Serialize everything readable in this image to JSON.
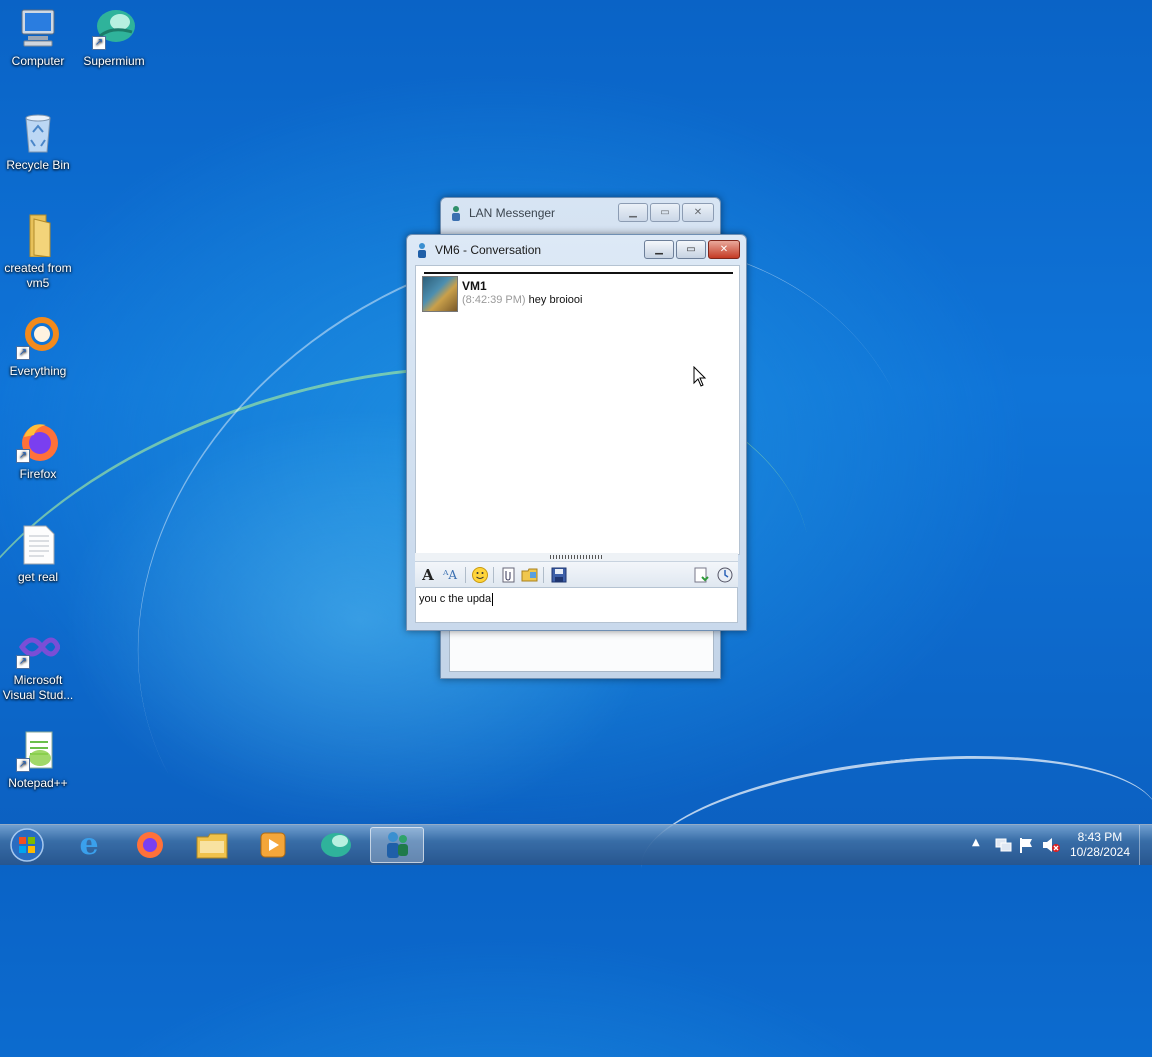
{
  "desktop": {
    "icons": [
      {
        "label": "Computer"
      },
      {
        "label": "Supermium"
      },
      {
        "label": "Recycle Bin"
      },
      {
        "label": "created from vm5"
      },
      {
        "label": "Everything"
      },
      {
        "label": "Firefox"
      },
      {
        "label": "get real"
      },
      {
        "label": "Microsoft Visual Stud..."
      },
      {
        "label": "Notepad++"
      }
    ]
  },
  "lan_window": {
    "title": "LAN Messenger"
  },
  "conversation": {
    "title": "VM6 - Conversation",
    "message": {
      "sender": "VM1",
      "time": "(8:42:39 PM)",
      "text": "hey broiooi"
    },
    "input_value": "you c the upda",
    "toolbar_icons": [
      "font-icon",
      "font-style-icon",
      "emoticon-icon",
      "attach-file-icon",
      "folder-icon",
      "save-icon",
      "history-icon",
      "transfers-icon"
    ]
  },
  "taskbar": {
    "items": [
      "start-orb",
      "internet-explorer",
      "firefox",
      "windows-explorer",
      "media-player",
      "supermium",
      "lan-messenger"
    ],
    "tray": [
      "show-hidden-icons",
      "network-icon",
      "action-center-flag-icon",
      "volume-muted-icon"
    ],
    "time": "8:43 PM",
    "date": "10/28/2024"
  },
  "colors": {
    "desktop_blue": "#0f74d8",
    "close_red": "#c43a24",
    "accent": "#2561b5"
  }
}
